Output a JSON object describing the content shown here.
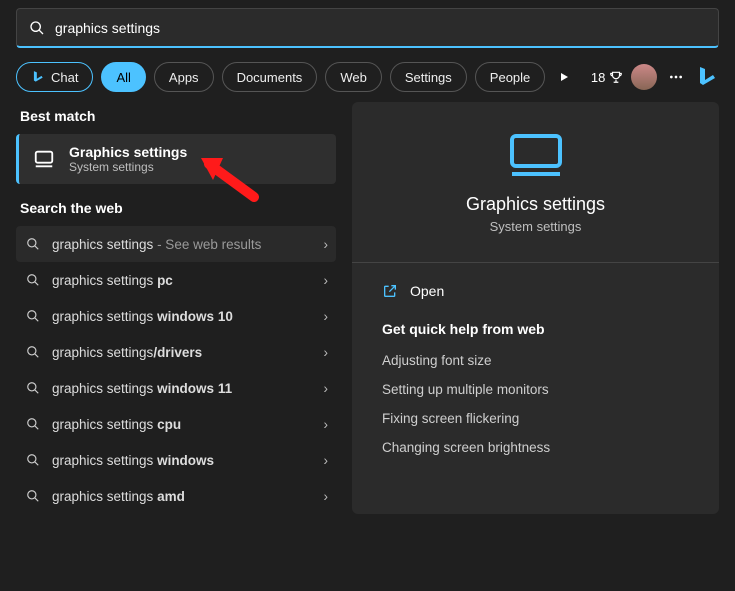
{
  "search": {
    "value": "graphics settings"
  },
  "filters": {
    "chat": "Chat",
    "all": "All",
    "apps": "Apps",
    "documents": "Documents",
    "web": "Web",
    "settings": "Settings",
    "people": "People"
  },
  "rewards": {
    "points": "18"
  },
  "left": {
    "best_match_header": "Best match",
    "best": {
      "title": "Graphics settings",
      "subtitle": "System settings"
    },
    "search_web_header": "Search the web",
    "web": [
      {
        "prefix": "graphics settings",
        "bold": "",
        "hint": " - See web results"
      },
      {
        "prefix": "graphics settings ",
        "bold": "pc",
        "hint": ""
      },
      {
        "prefix": "graphics settings ",
        "bold": "windows 10",
        "hint": ""
      },
      {
        "prefix": "graphics settings",
        "bold": "/drivers",
        "hint": ""
      },
      {
        "prefix": "graphics settings ",
        "bold": "windows 11",
        "hint": ""
      },
      {
        "prefix": "graphics settings ",
        "bold": "cpu",
        "hint": ""
      },
      {
        "prefix": "graphics settings ",
        "bold": "windows",
        "hint": ""
      },
      {
        "prefix": "graphics settings ",
        "bold": "amd",
        "hint": ""
      }
    ]
  },
  "right": {
    "title": "Graphics settings",
    "subtitle": "System settings",
    "open": "Open",
    "help_header": "Get quick help from web",
    "help_links": [
      "Adjusting font size",
      "Setting up multiple monitors",
      "Fixing screen flickering",
      "Changing screen brightness"
    ]
  }
}
